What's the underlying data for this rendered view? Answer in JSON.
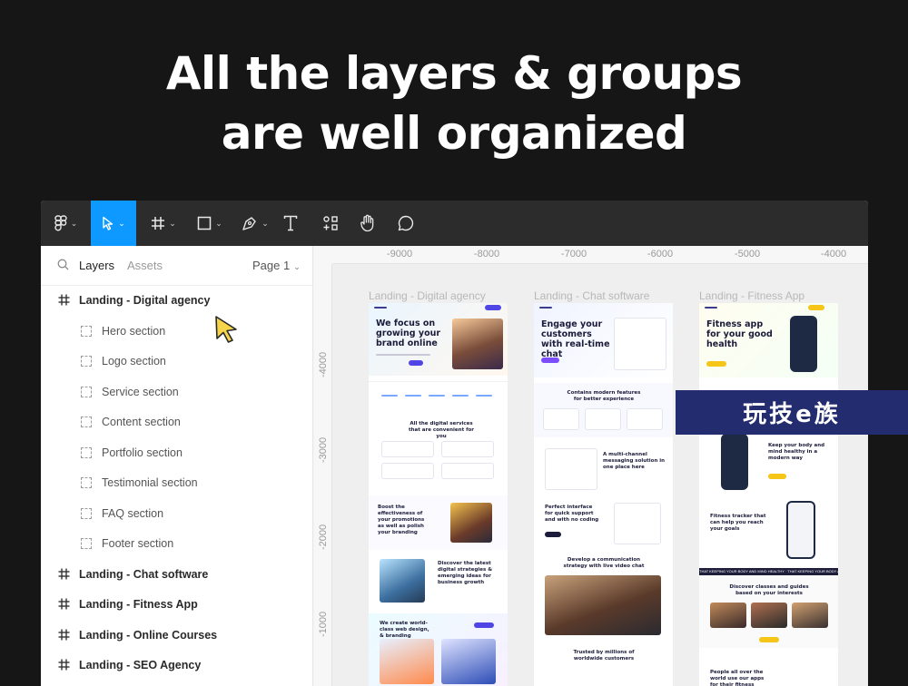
{
  "headline": {
    "line1": "All the layers & groups",
    "line2": "are well organized"
  },
  "toolbar": {
    "tools": [
      "figma-menu",
      "move",
      "frame",
      "shape",
      "pen",
      "text",
      "components",
      "hand",
      "comment"
    ],
    "active_tool": "move",
    "accent_color": "#0d99ff"
  },
  "layers_panel": {
    "tab_layers": "Layers",
    "tab_assets": "Assets",
    "page_selector": "Page 1",
    "items": [
      {
        "label": "Landing - Digital agency",
        "kind": "frame"
      },
      {
        "label": "Hero section",
        "kind": "section"
      },
      {
        "label": "Logo section",
        "kind": "section"
      },
      {
        "label": "Service section",
        "kind": "section"
      },
      {
        "label": "Content section",
        "kind": "section"
      },
      {
        "label": "Portfolio section",
        "kind": "section"
      },
      {
        "label": "Testimonial section",
        "kind": "section"
      },
      {
        "label": "FAQ section",
        "kind": "section"
      },
      {
        "label": "Footer section",
        "kind": "section"
      },
      {
        "label": "Landing - Chat software",
        "kind": "frame"
      },
      {
        "label": "Landing - Fitness App",
        "kind": "frame"
      },
      {
        "label": "Landing - Online Courses",
        "kind": "frame"
      },
      {
        "label": "Landing - SEO Agency",
        "kind": "frame"
      }
    ]
  },
  "canvas": {
    "ruler_top": [
      "-9000",
      "-8000",
      "-7000",
      "-6000",
      "-5000",
      "-4000"
    ],
    "ruler_left": [
      "-4000",
      "-3000",
      "-2000",
      "-1000"
    ],
    "frames": [
      {
        "title": "Landing - Digital agency",
        "hero": "We focus on growing your brand online",
        "services": "All the digital services that are convenient for you",
        "content1": "Boost the effectiveness of your promotions as well as polish your branding",
        "content2": "Discover the latest digital strategies & emerging ideas for business growth",
        "portfolio": "We create world-class web design, & branding"
      },
      {
        "title": "Landing - Chat software",
        "hero": "Engage your customers with real-time chat",
        "features": "Contains modern features for better experience",
        "multi": "A multi-channel messaging solution in one place here",
        "support": "Perfect interface for quick support and with no coding",
        "video": "Develop a communication strategy with live video chat",
        "trusted": "Trusted by millions of worldwide customers"
      },
      {
        "title": "Landing - Fitness App",
        "hero": "Fitness app for your good health",
        "body": "Keep your body and mind healthy in a modern way",
        "tracker": "Fitness tracker that can help you reach your goals",
        "banner": "THAT KEEPING YOUR BODY AND MIND HEALTHY  ·  THAT KEEPING YOUR BODY AND MIND HEALTHY",
        "classes": "Discover classes and guides based on your interests",
        "people": "People all over the world use our apps for their fitness"
      }
    ]
  },
  "watermark": "玩技e族"
}
